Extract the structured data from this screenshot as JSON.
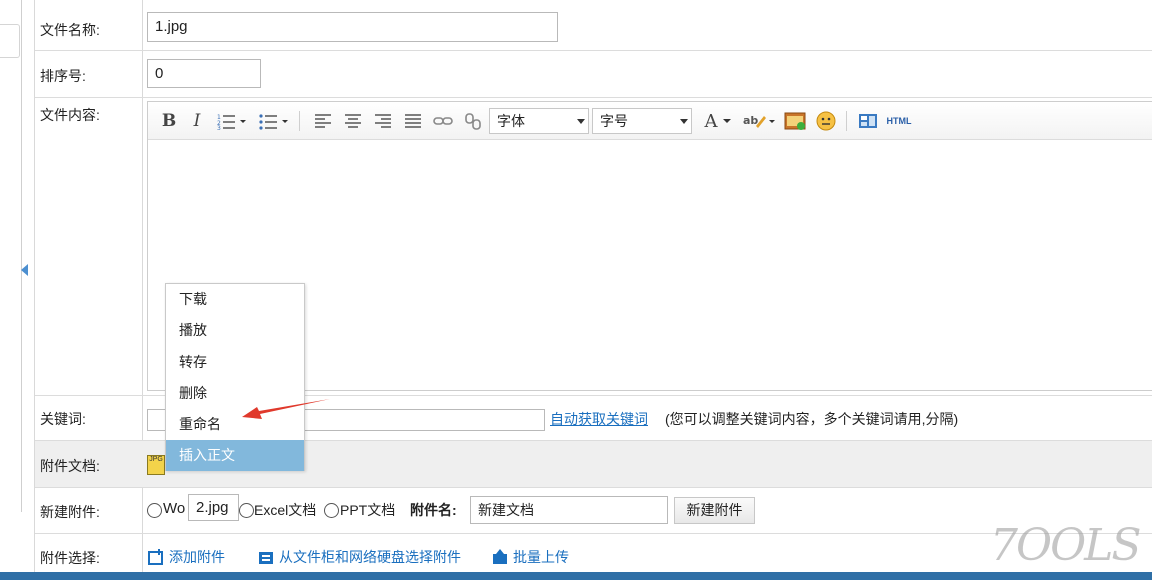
{
  "form": {
    "filename": {
      "label": "文件名称:",
      "value": "1.jpg"
    },
    "order": {
      "label": "排序号:",
      "value": "0"
    },
    "content": {
      "label": "文件内容:",
      "font_family": "字体",
      "font_size": "字号",
      "html_label": "HTML"
    },
    "keywords": {
      "label": "关键词:",
      "value": "",
      "auto_link": "自动获取关键词",
      "hint": "(您可以调整关键词内容，多个关键词请用,分隔)"
    },
    "attachments": {
      "label": "附件文档:"
    },
    "new_attachment": {
      "label": "新建附件:",
      "word_partial": "Wo",
      "rename_value": "2.jpg",
      "excel_label": "Excel文档",
      "ppt_label": "PPT文档",
      "name_label": "附件名:",
      "name_value": "新建文档",
      "create_button": "新建附件"
    },
    "attachment_select": {
      "label": "附件选择:",
      "add": "添加附件",
      "from_cabinet": "从文件柜和网络硬盘选择附件",
      "batch_upload": "批量上传"
    }
  },
  "context_menu": {
    "items": [
      "下载",
      "播放",
      "转存",
      "删除",
      "重命名",
      "插入正文"
    ],
    "active_index": 5
  },
  "watermark": "7OOLS",
  "colors": {
    "link": "#1a6fbf",
    "menu_highlight": "#82b8dc",
    "arrow": "#e0392c",
    "bottom_bar": "#2f6fa6"
  }
}
